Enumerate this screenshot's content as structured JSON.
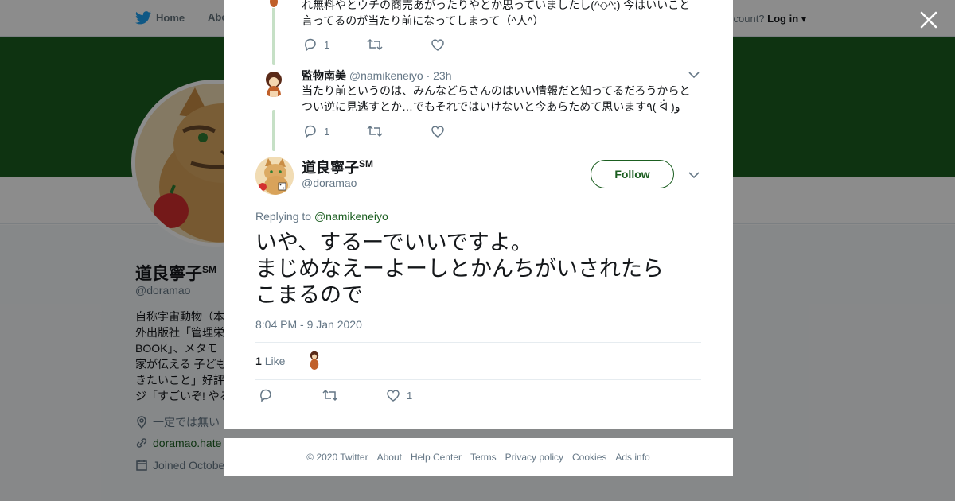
{
  "nav": {
    "home_label": "Home",
    "about_label": "Abo",
    "account_prompt": "ccount?",
    "login_label": "Log in"
  },
  "profile": {
    "name": "道良寧子",
    "name_suffix": "SM",
    "handle": "@doramao",
    "bio_lines": [
      "自称宇宙動物（本",
      "外出版社「管理栄",
      "BOOK」、メタモ",
      "家が伝える 子ども",
      "きたいこと」好評",
      "ジ「すごいぞ! やる"
    ],
    "location": "一定では無い",
    "link": "doramao.hate",
    "joined": "Joined Octobe"
  },
  "thread": {
    "prev_tweet": {
      "text_lines": [
        "れ無料やとウチの商売あがったりやとか思っていましたし(^◇^;)  今はいいこと",
        "言ってるのが当たり前になってしまって（^人^）"
      ],
      "reply_count": "1"
    },
    "parent_tweet": {
      "name": "監物南美",
      "handle": "@namikeneiyo",
      "time": "· 23h",
      "text_lines": [
        "当たり前というのは、みんなどらさんのはいい情報だと知ってるだろうからと",
        "つい逆に見逃すとか…でもそれではいけないと今あらためて思います٩( ᐛ )و"
      ],
      "reply_count": "1"
    }
  },
  "main_tweet": {
    "name": "道良寧子",
    "name_suffix": "SM",
    "handle": "@doramao",
    "follow_label": "Follow",
    "replying_prefix": "Replying to",
    "replying_to": "@namikeneiyo",
    "text_lines": [
      "いや、するーでいいですよ。",
      "まじめなえーよーしとかんちがいされたら",
      "こまるので"
    ],
    "timestamp": "8:04 PM - 9 Jan 2020",
    "like_count": "1",
    "like_label": "Like",
    "like_action_count": "1"
  },
  "footer": {
    "links": [
      "© 2020 Twitter",
      "About",
      "Help Center",
      "Terms",
      "Privacy policy",
      "Cookies",
      "Ads info"
    ]
  },
  "colors": {
    "accent": "#1b5e20",
    "banner": "#1b5e20",
    "thread_line": "#c6e0c6"
  },
  "icons": {
    "brand": "twitter-bird-icon",
    "close": "close-icon",
    "reply": "reply-icon",
    "retweet": "retweet-icon",
    "like": "heart-icon",
    "caret": "chevron-down-icon"
  }
}
